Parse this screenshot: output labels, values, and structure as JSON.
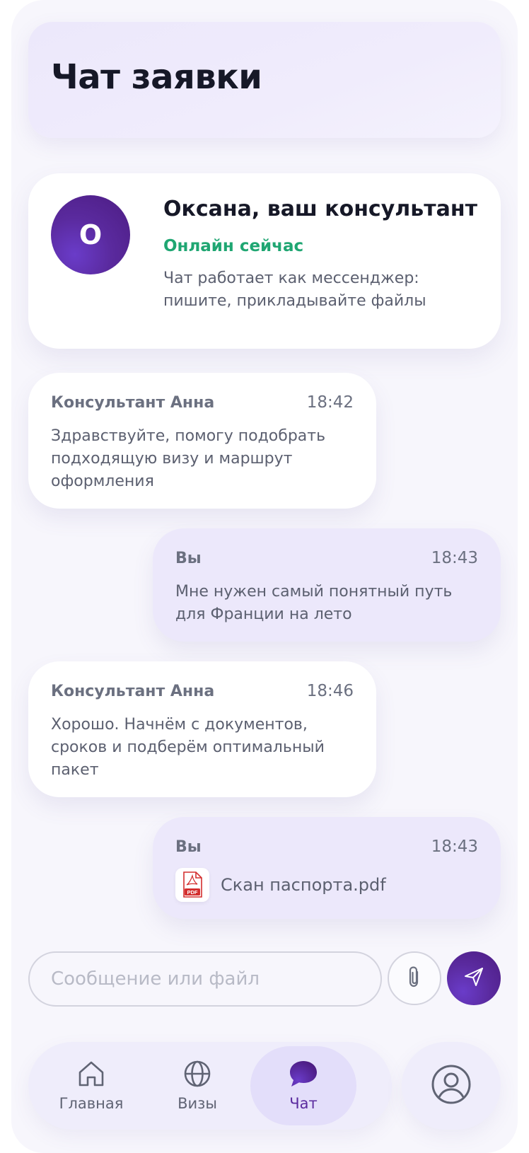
{
  "header": {
    "title": "Чат заявки"
  },
  "consultant": {
    "avatar_initial": "О",
    "name": "Оксана, ваш консультант",
    "status": "Онлайн сейчас",
    "description": "Чат работает как мессенджер: пишите, прикладывайте файлы"
  },
  "messages": [
    {
      "author": "Консультант Анна",
      "time": "18:42",
      "text": "Здравствуйте, помогу подобрать подходящую визу и маршрут оформления"
    },
    {
      "author": "Вы",
      "time": "18:43",
      "text": "Мне нужен самый понятный путь для Франции на лето"
    },
    {
      "author": "Консультант Анна",
      "time": "18:46",
      "text": "Хорошо. Начнём с документов, сроков и подберём оптимальный пакет"
    },
    {
      "author": "Вы",
      "time": "18:43",
      "file_name": "Скан паспорта.pdf",
      "file_icon": "pdf-file-icon",
      "file_icon_label": "PDF"
    }
  ],
  "composer": {
    "placeholder": "Сообщение или файл",
    "attach_icon": "paperclip-icon",
    "send_icon": "send-icon"
  },
  "tabbar": {
    "items": [
      {
        "label": "Главная",
        "icon": "home-icon",
        "active": false
      },
      {
        "label": "Визы",
        "icon": "globe-icon",
        "active": false
      },
      {
        "label": "Чат",
        "icon": "chat-bubble-icon",
        "active": true
      }
    ],
    "profile_icon": "profile-icon"
  },
  "colors": {
    "accent": "#5a2a9e",
    "online": "#1fa672",
    "background": "#f7f6fc",
    "outgoing_bubble": "#ece8fb"
  }
}
